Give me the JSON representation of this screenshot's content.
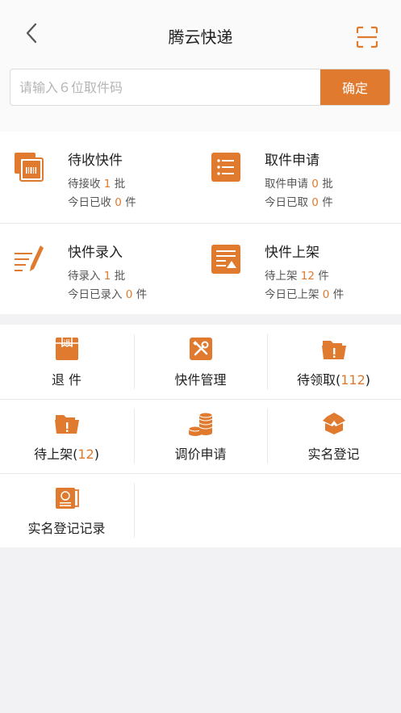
{
  "header": {
    "title": "腾云快递"
  },
  "search": {
    "placeholder": "请输入６位取件码",
    "confirm_label": "确定"
  },
  "cards": [
    {
      "title": "待收快件",
      "line1_prefix": "待接收",
      "line1_value": "1",
      "line1_suffix": "批",
      "line2_prefix": "今日已收",
      "line2_value": "0",
      "line2_suffix": "件",
      "icon": "package-stack-icon"
    },
    {
      "title": "取件申请",
      "line1_prefix": "取件申请",
      "line1_value": "0",
      "line1_suffix": "批",
      "line2_prefix": "今日已取",
      "line2_value": "0",
      "line2_suffix": "件",
      "icon": "list-icon"
    },
    {
      "title": "快件录入",
      "line1_prefix": "待录入",
      "line1_value": "1",
      "line1_suffix": "批",
      "line2_prefix": "今日已录入",
      "line2_value": "0",
      "line2_suffix": "件",
      "icon": "pen-lines-icon"
    },
    {
      "title": "快件上架",
      "line1_prefix": "待上架",
      "line1_value": "12",
      "line1_suffix": "件",
      "line2_prefix": "今日已上架",
      "line2_value": "0",
      "line2_suffix": "件",
      "icon": "shelf-doc-icon"
    }
  ],
  "grid": [
    {
      "label": "退 件",
      "count": "",
      "icon": "return-box-icon"
    },
    {
      "label": "快件管理",
      "count": "",
      "icon": "tools-icon"
    },
    {
      "label": "待领取",
      "count": "112",
      "icon": "folder-alert-icon"
    },
    {
      "label": "待上架",
      "count": "12",
      "icon": "folder-alert-icon"
    },
    {
      "label": "调价申请",
      "count": "",
      "icon": "coins-icon"
    },
    {
      "label": "实名登记",
      "count": "",
      "icon": "open-box-icon"
    },
    {
      "label": "实名登记记录",
      "count": "",
      "icon": "id-card-icon"
    }
  ],
  "colors": {
    "accent": "#e07a2e",
    "background": "#f2f2f4"
  }
}
